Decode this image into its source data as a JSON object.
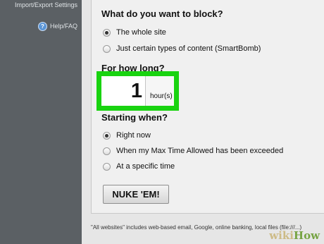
{
  "sidebar": {
    "import_export": "Import/Export Settings",
    "help": "Help/FAQ"
  },
  "block_question": "What do you want to block?",
  "block_options": [
    {
      "label": "The whole site",
      "selected": true
    },
    {
      "label": "Just certain types of content (SmartBomb)",
      "selected": false
    }
  ],
  "duration": {
    "question": "For how long?",
    "value": "1",
    "unit": "hour(s)",
    "highlight_color": "#19d310"
  },
  "start_question": "Starting when?",
  "start_options": [
    {
      "label": "Right now",
      "selected": true
    },
    {
      "label": "When my Max Time Allowed has been exceeded",
      "selected": false
    },
    {
      "label": "At a specific time",
      "selected": false
    }
  ],
  "nuke_button": "NUKE 'EM!",
  "footer": "\"All websites\" includes web-based email, Google, online banking, local files (file:///...)",
  "watermark": {
    "wiki": "wiki",
    "how": "How"
  }
}
